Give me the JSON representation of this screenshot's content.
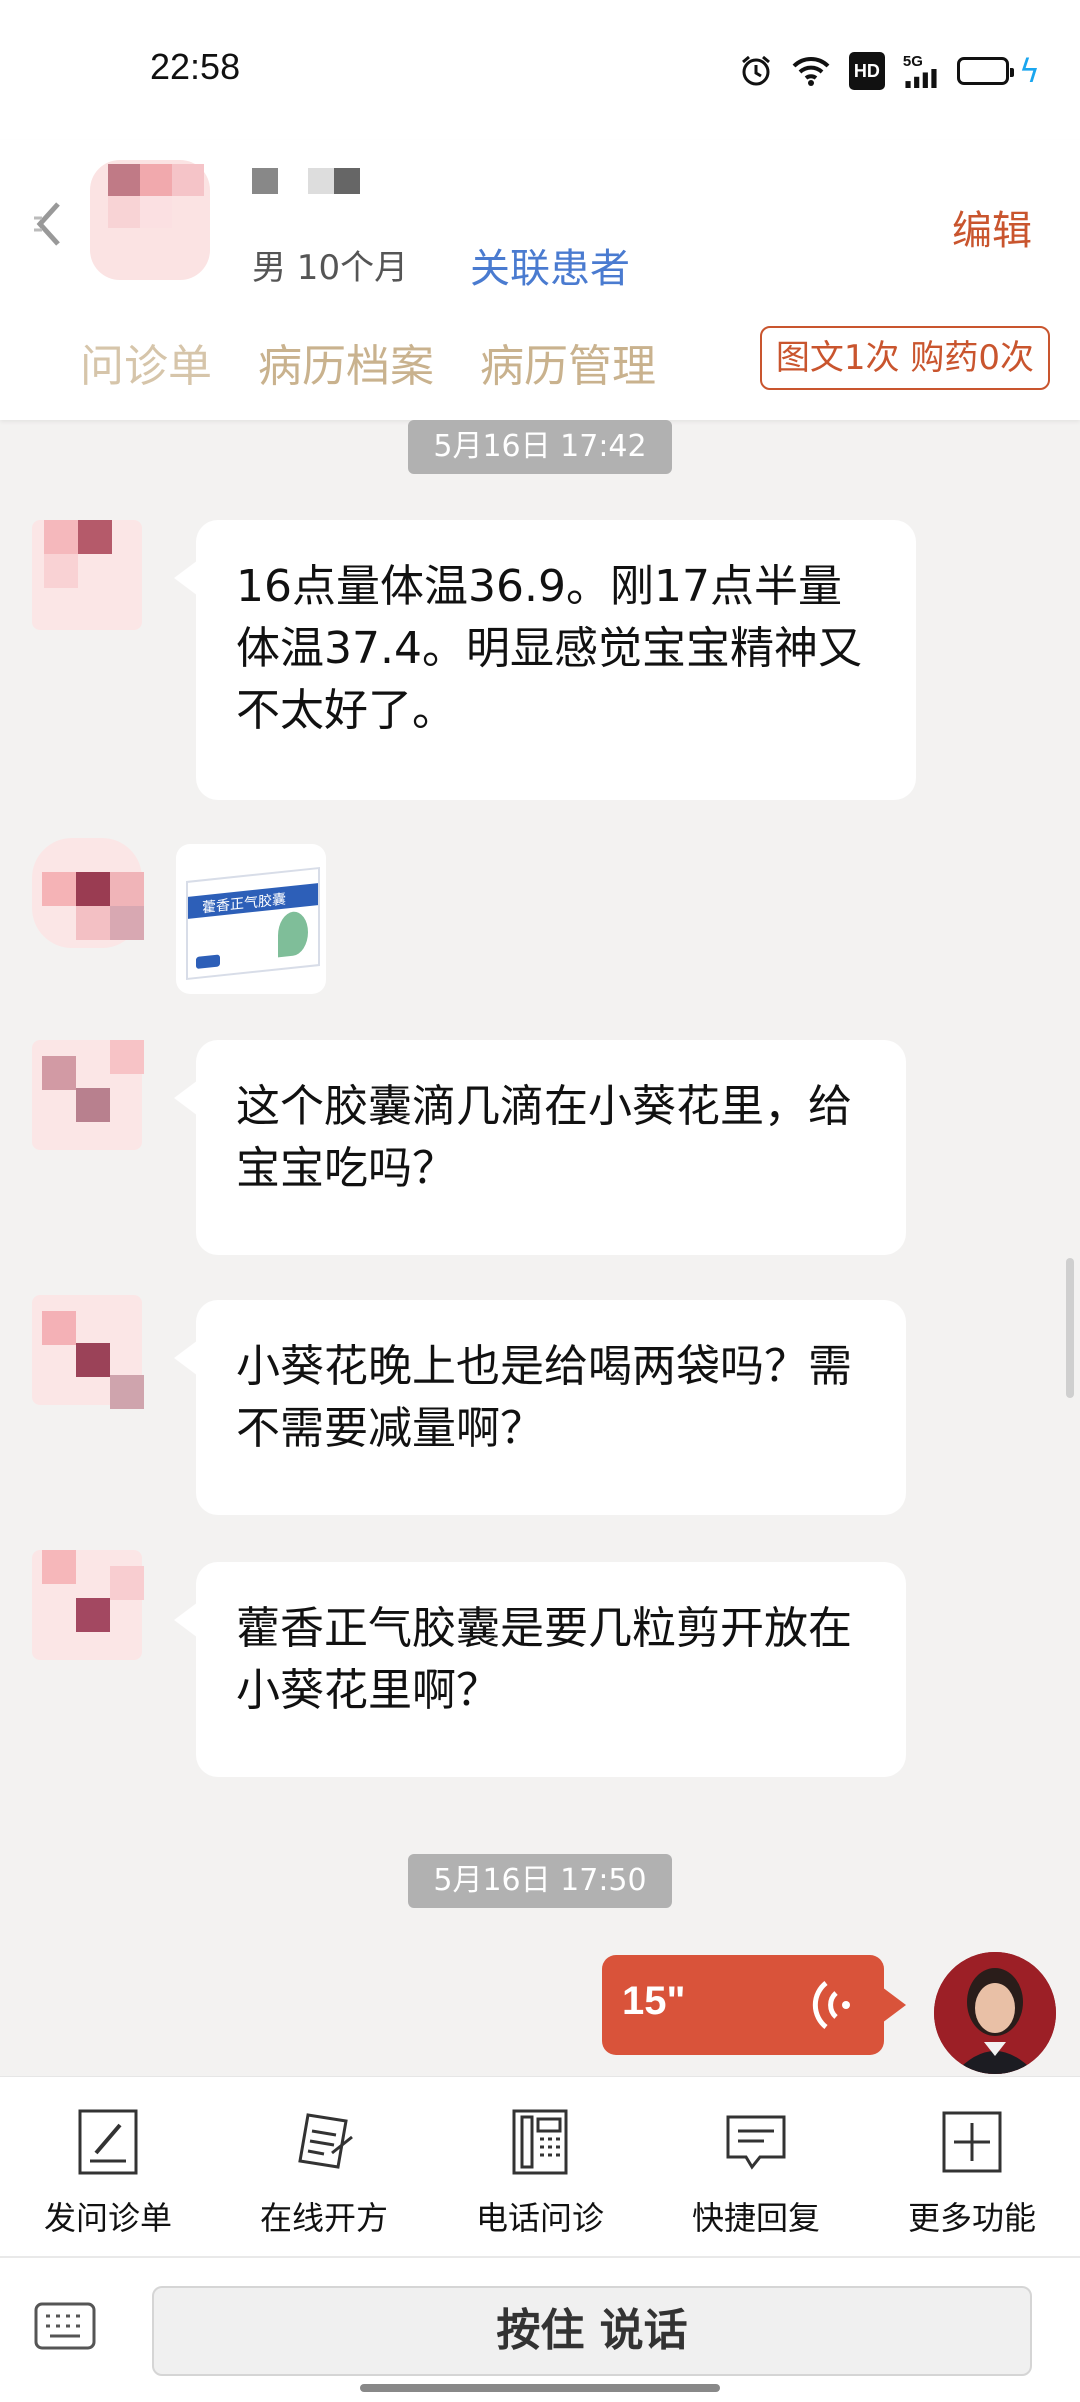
{
  "status_bar": {
    "time": "22:58",
    "icons": [
      "alarm-icon",
      "wifi-icon",
      "hd-icon",
      "signal-5g-icon",
      "battery-icon",
      "charging-icon"
    ],
    "hd_label": "HD",
    "network_label": "5G"
  },
  "header": {
    "patient_meta": "男 10个月",
    "link_patient_label": "关联患者",
    "edit_label": "编辑",
    "tabs": [
      {
        "label": "问诊单"
      },
      {
        "label": "病历档案"
      },
      {
        "label": "病历管理"
      }
    ],
    "count_badge": "图文1次 购药0次"
  },
  "chat": {
    "time_1": "5月16日 17:42",
    "messages": [
      {
        "text": "16点量体温36.9。刚17点半量体温37.4。明显感觉宝宝精神又不太好了。"
      },
      {
        "image_text": "藿香正气胶囊"
      },
      {
        "text": "这个胶囊滴几滴在小葵花里，给宝宝吃吗？"
      },
      {
        "text": "小葵花晚上也是给喝两袋吗？需不需要减量啊？"
      },
      {
        "text": "藿香正气胶囊是要几粒剪开放在小葵花里啊？"
      }
    ],
    "time_2": "5月16日 17:50",
    "voice": {
      "duration": "15\""
    }
  },
  "colors": {
    "accent": "#c9552e",
    "voice_bubble": "#d9533a",
    "tab_text": "#c9b28e",
    "link": "#4a7bd0",
    "chat_bg": "#f3f2f1"
  },
  "toolbar": {
    "items": [
      {
        "label": "发问诊单",
        "icon": "form-pen-icon"
      },
      {
        "label": "在线开方",
        "icon": "prescription-icon"
      },
      {
        "label": "电话问诊",
        "icon": "phone-icon"
      },
      {
        "label": "快捷回复",
        "icon": "chat-reply-icon"
      },
      {
        "label": "更多功能",
        "icon": "plus-box-icon"
      }
    ]
  },
  "input_bar": {
    "push_to_talk_label": "按住 说话",
    "keyboard_icon": "keyboard-icon"
  }
}
